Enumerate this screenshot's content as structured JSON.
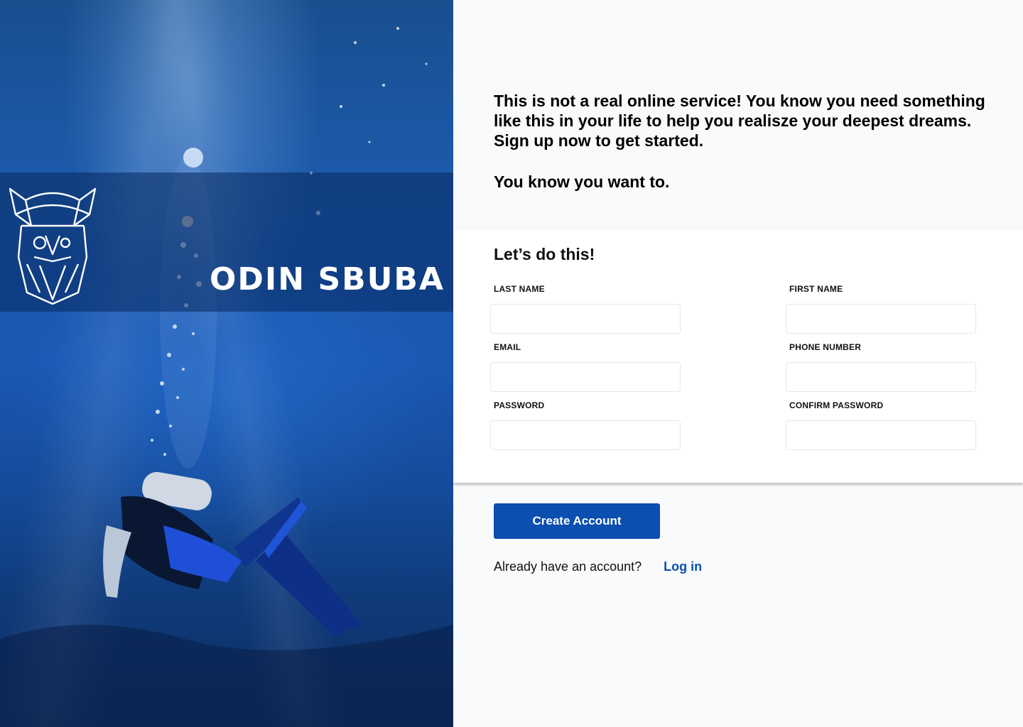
{
  "brand": {
    "name": "ODIN SBUBA",
    "logo_icon": "viking-helmet-icon"
  },
  "intro": {
    "paragraph_1": "This is not a real online service! You know you need something like this in your life to help you realisze your deepest dreams. Sign up now to get started.",
    "paragraph_2": "You know you want to."
  },
  "form": {
    "heading": "Let’s do this!",
    "fields": {
      "last_name": {
        "label": "LAST NAME",
        "value": "",
        "placeholder": ""
      },
      "first_name": {
        "label": "FIRST NAME",
        "value": "",
        "placeholder": ""
      },
      "email": {
        "label": "EMAIL",
        "value": "",
        "placeholder": ""
      },
      "phone_number": {
        "label": "PHONE NUMBER",
        "value": "",
        "placeholder": ""
      },
      "password": {
        "label": "PASSWORD",
        "value": "",
        "placeholder": ""
      },
      "confirm_password": {
        "label": "CONFIRM PASSWORD",
        "value": "",
        "placeholder": ""
      }
    }
  },
  "actions": {
    "create_account_label": "Create Account",
    "login_prompt": "Already have an account?",
    "login_link_label": "Log in"
  },
  "colors": {
    "accent": "#0b4fb0",
    "page_background": "#f8fafc",
    "card_background": "#ffffff"
  }
}
